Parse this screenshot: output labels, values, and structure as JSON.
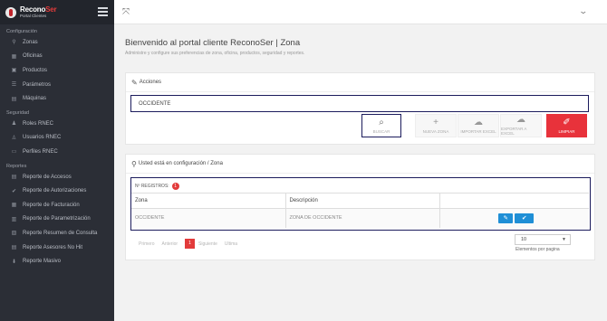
{
  "brand": {
    "name_a": "Recono",
    "name_b": "Ser",
    "sub": "Portal Clientes"
  },
  "sidebar": {
    "sections": [
      {
        "title": "Configuración",
        "items": [
          {
            "label": "Zonas",
            "icon": "map-pin-icon"
          },
          {
            "label": "Oficinas",
            "icon": "building-icon"
          },
          {
            "label": "Productos",
            "icon": "box-icon"
          },
          {
            "label": "Parámetros",
            "icon": "list-icon"
          },
          {
            "label": "Máquinas",
            "icon": "server-icon"
          }
        ]
      },
      {
        "title": "Seguridad",
        "items": [
          {
            "label": "Roles RNEC",
            "icon": "user-group-icon"
          },
          {
            "label": "Usuarios RNEC",
            "icon": "users-icon"
          },
          {
            "label": "Perfiles RNEC",
            "icon": "id-card-icon"
          }
        ]
      },
      {
        "title": "Reportes",
        "items": [
          {
            "label": "Reporte de Accesos",
            "icon": "report-icon"
          },
          {
            "label": "Reporte de Autorizaciones",
            "icon": "check-icon"
          },
          {
            "label": "Reporte de Facturación",
            "icon": "invoice-icon"
          },
          {
            "label": "Reporte de Parametrización",
            "icon": "settings-report-icon"
          },
          {
            "label": "Reporte Resumen de Consulta",
            "icon": "chart-icon"
          },
          {
            "label": "Reporte Asesores No Hit",
            "icon": "report-alt-icon"
          },
          {
            "label": "Reporte Masivo",
            "icon": "download-icon"
          }
        ]
      }
    ]
  },
  "header": {
    "title": "Bienvenido al portal cliente ReconoSer | Zona",
    "subtitle": "Administre y configure sus preferencias de zona, oficina, productos, seguridad y reportes."
  },
  "actions_panel": {
    "title": "Acciones",
    "input_value": "OCCIDENTE",
    "buttons": {
      "search": "BUSCAR",
      "new": "NUEVA ZONA",
      "import": "IMPORTAR EXCEL",
      "export": "EXPORTAR A EXCEL",
      "clear": "LIMPIAR"
    }
  },
  "config_panel": {
    "title": "Usted está en configuración / Zona",
    "records_label": "Nº REGISTROS:",
    "records_count": "1",
    "columns": [
      "Zona",
      "Descripción",
      ""
    ],
    "rows": [
      {
        "zona": "OCCIDENTE",
        "descripcion": "ZONA DE OCCIDENTE"
      }
    ],
    "pager": {
      "first": "Primero",
      "prev": "Anterior",
      "current": "1",
      "next": "Siguiente",
      "last": "Ultima"
    },
    "per_page_value": "10",
    "per_page_label": "Elementos por pagina"
  },
  "colors": {
    "accent": "#e23b3b",
    "sidebar": "#2b2e36",
    "primary_button": "#1f8fd6",
    "highlight_border": "#1b1b5c"
  }
}
